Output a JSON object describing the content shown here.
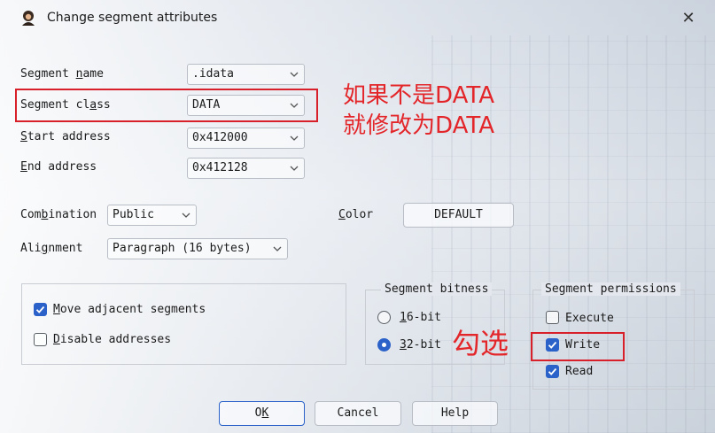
{
  "window": {
    "title": "Change segment attributes",
    "close_symbol": "✕"
  },
  "fields": {
    "segment_name": {
      "label_pre": "Segment ",
      "label_u": "n",
      "label_post": "ame",
      "value": ".idata"
    },
    "segment_class": {
      "label_pre": "Segment cl",
      "label_u": "a",
      "label_post": "ss",
      "value": "DATA"
    },
    "start_address": {
      "label_pre": "",
      "label_u": "S",
      "label_post": "tart address",
      "value": "0x412000"
    },
    "end_address": {
      "label_pre": "",
      "label_u": "E",
      "label_post": "nd address",
      "value": "0x412128"
    },
    "combination": {
      "label_pre": "Com",
      "label_u": "b",
      "label_post": "ination",
      "value": "Public"
    },
    "alignment": {
      "label_pre": "Ali",
      "label_u": "g",
      "label_post": "nment",
      "value": "Paragraph (16 bytes)"
    },
    "color": {
      "label_pre": "",
      "label_u": "C",
      "label_post": "olor",
      "button": "DEFAULT"
    }
  },
  "options": {
    "move_adjacent": {
      "label_pre": "",
      "label_u": "M",
      "label_post": "ove adjacent segments",
      "checked": true
    },
    "disable_addresses": {
      "label_pre": "",
      "label_u": "D",
      "label_post": "isable addresses",
      "checked": false
    }
  },
  "bitness": {
    "title": "Segment bitness",
    "bit16": {
      "label_pre": "",
      "label_u": "1",
      "label_post": "6-bit",
      "selected": false
    },
    "bit32": {
      "label_pre": "",
      "label_u": "3",
      "label_post": "2-bit",
      "selected": true
    }
  },
  "permissions": {
    "title": "Segment permissions",
    "execute": {
      "label": "Execute",
      "checked": false
    },
    "write": {
      "label": "Write",
      "checked": true
    },
    "read": {
      "label": "Read",
      "checked": true
    }
  },
  "buttons": {
    "ok": {
      "label_pre": "O",
      "label_u": "K",
      "label_post": ""
    },
    "cancel": "Cancel",
    "help": "Help"
  },
  "annotations": {
    "class_note_line1": "如果不是DATA",
    "class_note_line2": "就修改为DATA",
    "write_note": "勾选"
  },
  "colors": {
    "accent": "#2a62c9",
    "annotation_red": "#e3262a"
  }
}
